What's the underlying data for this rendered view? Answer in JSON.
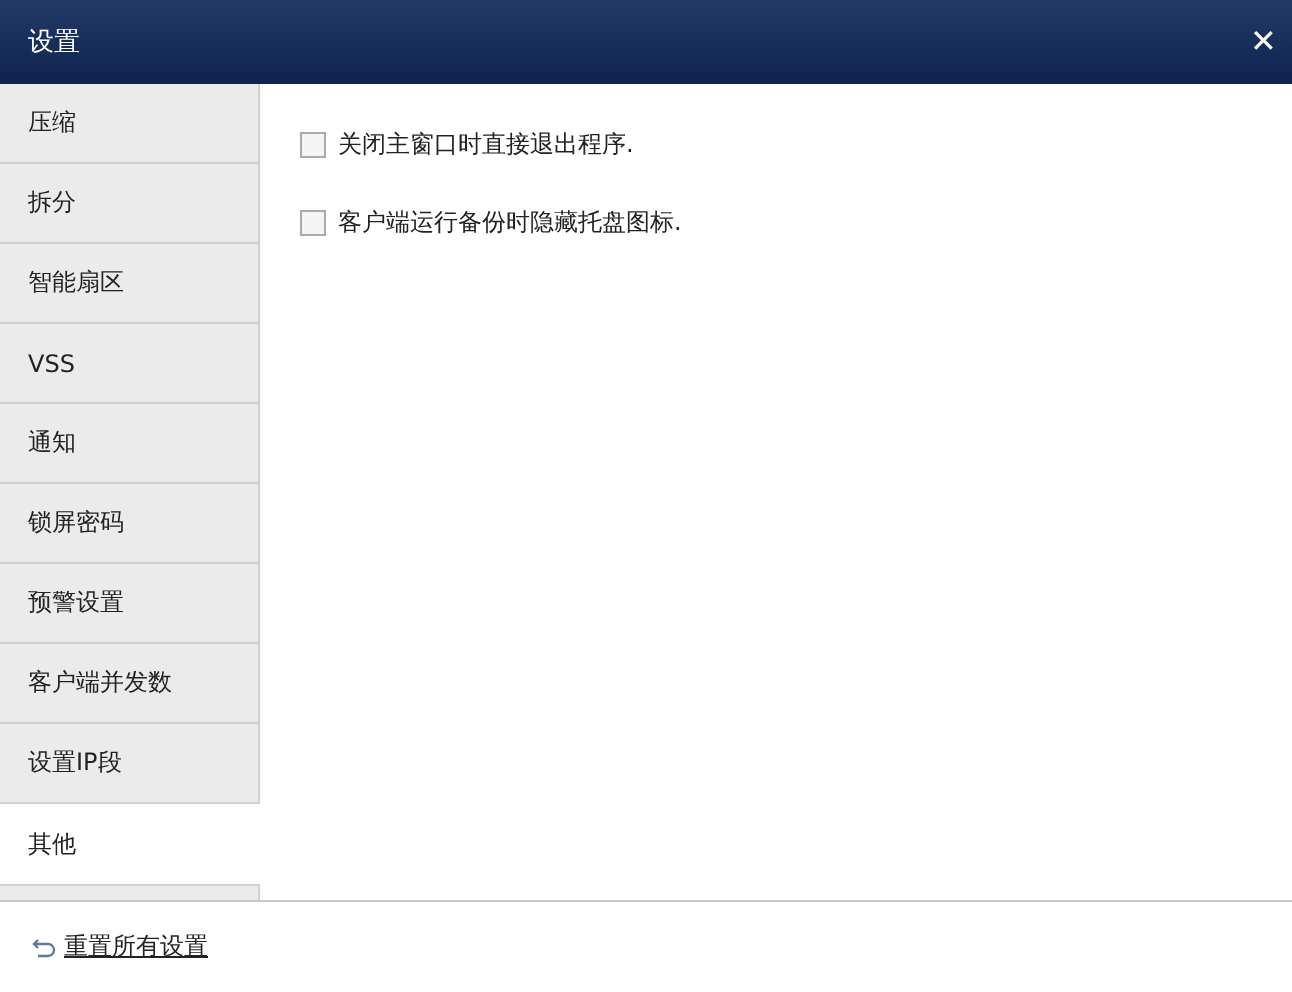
{
  "window": {
    "title": "设置",
    "close": "✕"
  },
  "sidebar": {
    "items": [
      {
        "label": "压缩",
        "selected": false
      },
      {
        "label": "拆分",
        "selected": false
      },
      {
        "label": "智能扇区",
        "selected": false
      },
      {
        "label": "VSS",
        "selected": false
      },
      {
        "label": "通知",
        "selected": false
      },
      {
        "label": "锁屏密码",
        "selected": false
      },
      {
        "label": "预警设置",
        "selected": false
      },
      {
        "label": "客户端并发数",
        "selected": false
      },
      {
        "label": "设置IP段",
        "selected": false
      },
      {
        "label": "其他",
        "selected": true
      }
    ]
  },
  "options": [
    {
      "label": "关闭主窗口时直接退出程序.",
      "checked": false
    },
    {
      "label": "客户端运行备份时隐藏托盘图标.",
      "checked": false
    }
  ],
  "footer": {
    "reset_link": "重置所有设置"
  }
}
